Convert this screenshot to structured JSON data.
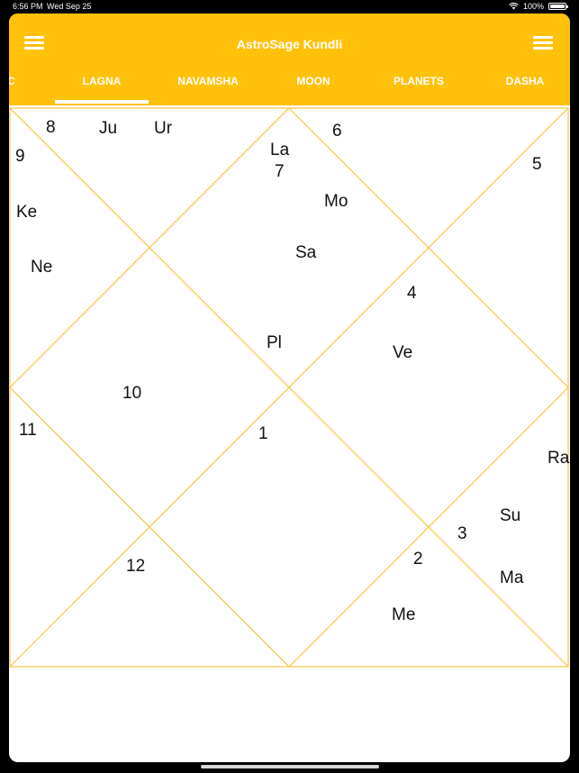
{
  "status_bar": {
    "time": "6:56 PM",
    "date": "Wed Sep 25",
    "battery_text": "100%"
  },
  "header": {
    "title": "AstroSage Kundli",
    "background_color": "#FFC10A"
  },
  "tabs": [
    {
      "label": "C",
      "selected": false
    },
    {
      "label": "LAGNA",
      "selected": true
    },
    {
      "label": "NAVAMSHA",
      "selected": false
    },
    {
      "label": "MOON",
      "selected": false
    },
    {
      "label": "PLANETS",
      "selected": false
    },
    {
      "label": "DASHA",
      "selected": false
    }
  ],
  "chart": {
    "line_color": "#F5C542",
    "house_numbers": [
      "8",
      "9",
      "7",
      "6",
      "5",
      "4",
      "10",
      "11",
      "1",
      "3",
      "2",
      "12"
    ],
    "planets": [
      "Ju",
      "Ur",
      "Ke",
      "Ne",
      "La",
      "Mo",
      "Sa",
      "Pl",
      "Ve",
      "Ra",
      "Su",
      "Ma",
      "Me"
    ]
  }
}
